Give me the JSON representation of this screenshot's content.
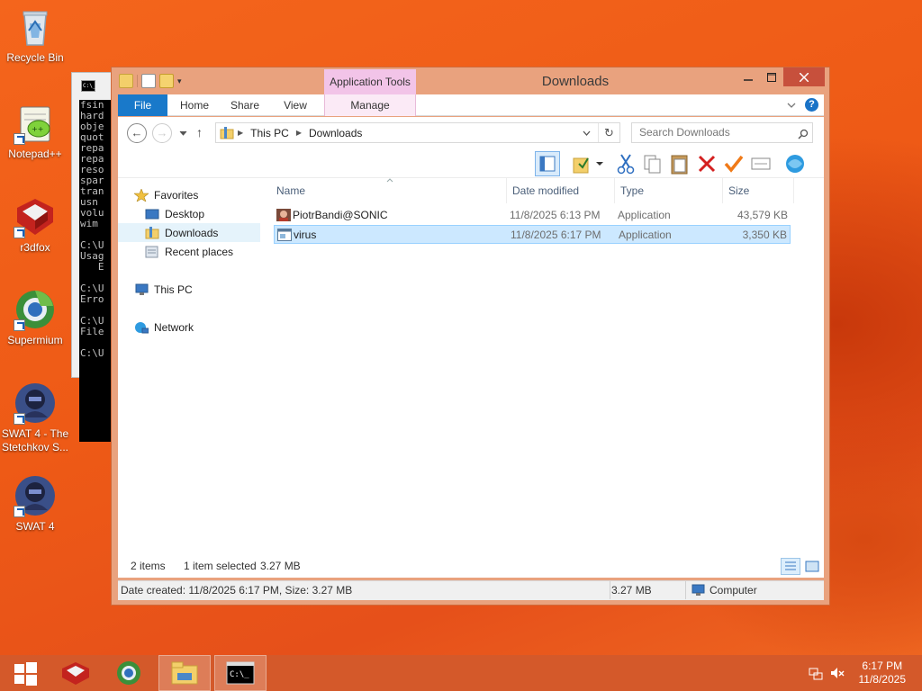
{
  "desktop": {
    "icons": [
      {
        "label": "Recycle Bin"
      },
      {
        "label": "Notepad++"
      },
      {
        "label": "r3dfox"
      },
      {
        "label": "Supermium"
      },
      {
        "label": "SWAT 4 - The Stetchkov S..."
      },
      {
        "label": "SWAT 4"
      }
    ]
  },
  "cmd": {
    "icon_text": "C:\\_",
    "lines": "fsin\nhard\nobje\nquot\nrepa\nrepa\nreso\nspar\ntran\nusn\nvolu\nwim\n\nC:\\U\nUsag\n   E\n\nC:\\U\nErro\n\nC:\\U\nFile\n\nC:\\U"
  },
  "explorer": {
    "title": "Downloads",
    "context_tab": "Application Tools",
    "tabs": [
      "File",
      "Home",
      "Share",
      "View",
      "Manage"
    ],
    "breadcrumb": [
      "This PC",
      "Downloads"
    ],
    "search_placeholder": "Search Downloads",
    "nav": {
      "favorites": "Favorites",
      "desktop": "Desktop",
      "downloads": "Downloads",
      "recent": "Recent places",
      "this_pc": "This PC",
      "network": "Network"
    },
    "columns": {
      "name": "Name",
      "date": "Date modified",
      "type": "Type",
      "size": "Size"
    },
    "files": [
      {
        "name": "PiotrBandi@SONIC",
        "date": "11/8/2025 6:13 PM",
        "type": "Application",
        "size": "43,579 KB"
      },
      {
        "name": "virus",
        "date": "11/8/2025 6:17 PM",
        "type": "Application",
        "size": "3,350 KB"
      }
    ],
    "status": {
      "items": "2 items",
      "selected": "1 item selected",
      "selected_size": "3.27 MB"
    },
    "details": {
      "info": "Date created: 11/8/2025 6:17 PM, Size: 3.27 MB",
      "size": "3.27 MB",
      "location": "Computer"
    }
  },
  "taskbar": {
    "time": "6:17 PM",
    "date": "11/8/2025"
  },
  "colors": {
    "file_tab": "#1979ca",
    "context_tab": "#f2c4e8",
    "selection": "#cce8ff",
    "close_button": "#c7503c"
  }
}
